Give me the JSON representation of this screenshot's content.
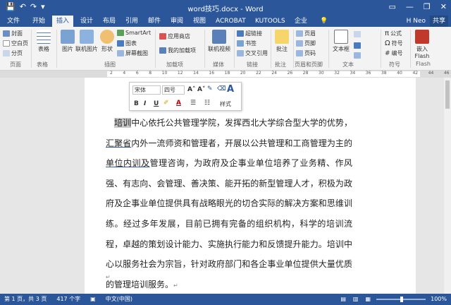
{
  "window": {
    "title": "word技巧.docx - Word",
    "qat": [
      "💾",
      "↶",
      "↷",
      "▾"
    ],
    "controls": [
      "▭",
      "—",
      "❐",
      "✕"
    ]
  },
  "tabs": [
    {
      "label": "文件"
    },
    {
      "label": "开始"
    },
    {
      "label": "插入"
    },
    {
      "label": "设计"
    },
    {
      "label": "布局"
    },
    {
      "label": "引用"
    },
    {
      "label": "邮件"
    },
    {
      "label": "审阅"
    },
    {
      "label": "视图"
    },
    {
      "label": "ACROBAT"
    },
    {
      "label": "KUTOOLS"
    },
    {
      "label": "企业"
    }
  ],
  "active_tab": "插入",
  "search_icon": "💡",
  "user": "H Neo",
  "share_label": "共享",
  "ribbon": {
    "pages_group": {
      "items": [
        "封面",
        "空白页",
        "分页"
      ],
      "label": "页面"
    },
    "table": {
      "label": "表格",
      "group": "表格"
    },
    "illustrations": {
      "items": [
        "图片",
        "联机图片",
        "形状"
      ],
      "small": [
        "SmartArt",
        "图表",
        "屏幕截图"
      ],
      "label": "插图"
    },
    "addins": {
      "items": [
        "应用商店",
        "我的加载项"
      ],
      "label": "加载项"
    },
    "media": {
      "label": "联机视频",
      "group": "媒体"
    },
    "links": {
      "items": [
        "超链接",
        "书签",
        "交叉引用"
      ],
      "label": "链接"
    },
    "comments": {
      "label": "批注",
      "group": "批注"
    },
    "header_footer": {
      "items": [
        "页眉",
        "页脚",
        "页码"
      ],
      "label": "页眉和页脚"
    },
    "text": {
      "label": "文本框",
      "group": "文本"
    },
    "symbols": {
      "items": [
        "公式",
        "符号",
        "编号"
      ],
      "label": "符号"
    },
    "flash": {
      "label": "嵌入Flash",
      "group": "Flash"
    }
  },
  "ruler_numbers": [
    "2",
    "4",
    "6",
    "8",
    "10",
    "12",
    "14",
    "16",
    "18",
    "20",
    "22",
    "24",
    "26",
    "28",
    "30",
    "32",
    "34",
    "36",
    "38",
    "40",
    "42",
    "44",
    "46",
    "48"
  ],
  "mini_toolbar": {
    "font": "宋体",
    "size": "四号",
    "grow": "A˄",
    "shrink": "A˅",
    "bold": "B",
    "italic": "I",
    "underline": "U",
    "style_label": "样式"
  },
  "document": {
    "highlighted": "培训",
    "text_part1": "中心依托公共管理学院，发挥西北大学综合型大学的优势，",
    "underlined1": "汇聚省",
    "text_part2": "内外一流师资和管理者，开展以公共管理和工商管理为主的",
    "underlined2": "单位内训及",
    "text_part3": "管理咨询，为政府及企事业单位培养了业务精、作风强、有志向、会管理、善决策、能开拓的新型管理人才，积极为政府及企事业单位提供具有战略眼光的切合实际的解决方案和思维训练。经过多年发展，目前已拥有完备的组织机构，科学的培训流程，卓越的策划设计能力、实施执行能力和反馈提升能力。培训中心以服务社会为宗旨，针对政府部门和各企事业单位提供大量优质的管理培训服务。",
    "para_mark": "↵",
    "empty_para_mark": "↵"
  },
  "status": {
    "page": "第 1 页，共 3 页",
    "words": "417 个字",
    "language": "中文(中国)",
    "zoom": "100%"
  },
  "colors": {
    "accent": "#2b579a",
    "ribbon_bg": "#f3f3f3",
    "highlight": "#c8c8c8"
  }
}
